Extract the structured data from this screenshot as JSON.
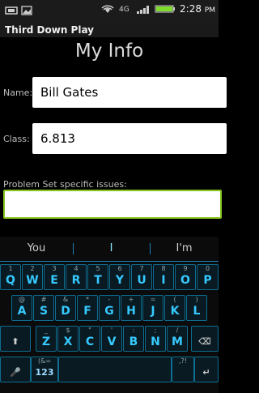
{
  "statusbar": {
    "time": "2:28",
    "ampm": "PM"
  },
  "app": {
    "title": "Third Down Play"
  },
  "page": {
    "title": "My Info"
  },
  "form": {
    "name_label": "Name:",
    "name_value": "Bill Gates",
    "class_label": "Class:",
    "class_value": "6.813",
    "issues_label": "Problem Set specific issues:",
    "issues_value": ""
  },
  "keyboard": {
    "suggestions": [
      "You",
      "I",
      "I'm"
    ],
    "row1_numbers": [
      "1",
      "2",
      "3",
      "4",
      "5",
      "6",
      "7",
      "8",
      "9",
      "0"
    ],
    "row1_keys": [
      "Q",
      "W",
      "E",
      "R",
      "T",
      "Y",
      "U",
      "I",
      "O",
      "P"
    ],
    "row2_sup": [
      "@",
      "#",
      "&",
      "*",
      "-",
      "+",
      "=",
      "(",
      ")"
    ],
    "row2_keys": [
      "A",
      "S",
      "D",
      "F",
      "G",
      "H",
      "J",
      "K",
      "L"
    ],
    "row3_sup": [
      "_",
      "$",
      "\"",
      "'",
      ":",
      ";",
      "/"
    ],
    "row3_keys": [
      "Z",
      "X",
      "C",
      "V",
      "B",
      "N",
      "M"
    ],
    "row4_special_left_sup": "(&=",
    "row4_special_left_main": "123",
    "row4_right_sup": ",?!"
  },
  "colors": {
    "accent": "#36c9ff",
    "focus_border": "#87c51e",
    "battery": "#7fdc2c"
  }
}
